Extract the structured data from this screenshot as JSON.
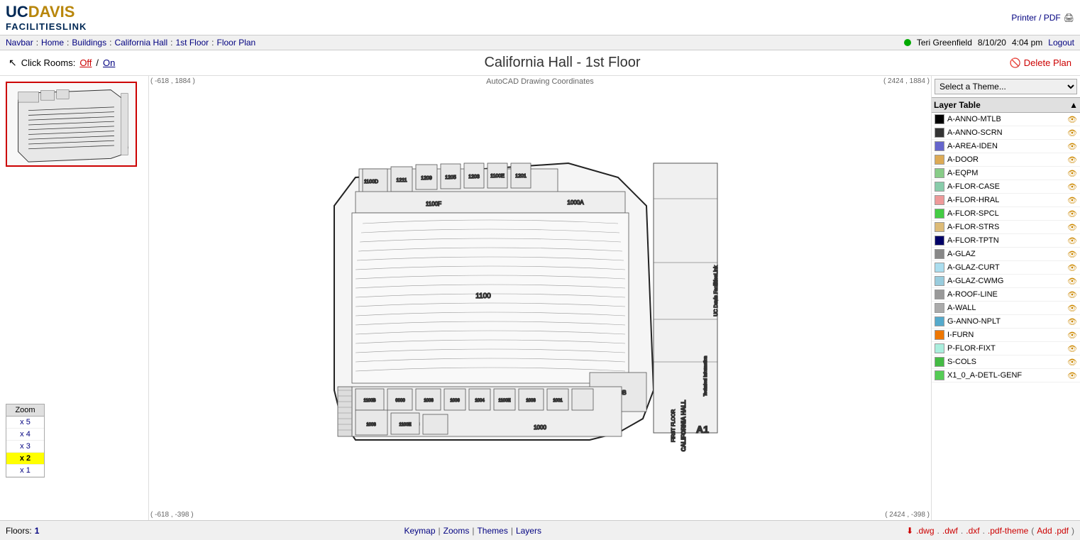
{
  "header": {
    "logo_uc": "UC",
    "logo_davis": "DAVIS",
    "logo_facilities": "FACILITIESLINK",
    "printer_pdf": "Printer / PDF"
  },
  "navbar": {
    "label": "Navbar",
    "items": [
      "Home",
      "Buildings",
      "California Hall",
      "1st Floor",
      "Floor Plan"
    ],
    "user": "Teri Greenfield",
    "date": "8/10/20",
    "time": "4:04 pm",
    "logout": "Logout"
  },
  "titlebar": {
    "click_rooms_label": "Click Rooms:",
    "click_rooms_off": "Off",
    "click_rooms_slash": "/",
    "click_rooms_on": "On",
    "title": "California Hall - 1st Floor",
    "delete_plan": "Delete Plan"
  },
  "map": {
    "coord_top_left": "( -618 , 1884 )",
    "coord_top_right": "( 2424 , 1884 )",
    "coord_bottom_left": "( -618 , -398 )",
    "coord_bottom_right": "( 2424 , -398 )",
    "autocad_label": "AutoCAD Drawing Coordinates"
  },
  "zoom": {
    "label": "Zoom",
    "levels": [
      "x 5",
      "x 4",
      "x 3",
      "x 2",
      "x 1"
    ],
    "active": "x 2"
  },
  "right_panel": {
    "theme_placeholder": "Select a Theme...",
    "layer_table_header": "Layer Table",
    "layers": [
      {
        "name": "A-ANNO-MTLB",
        "color": "#000000"
      },
      {
        "name": "A-ANNO-SCRN",
        "color": "#333333"
      },
      {
        "name": "A-AREA-IDEN",
        "color": "#6666cc"
      },
      {
        "name": "A-DOOR",
        "color": "#ddaa55"
      },
      {
        "name": "A-EQPM",
        "color": "#88cc88"
      },
      {
        "name": "A-FLOR-CASE",
        "color": "#88ccaa"
      },
      {
        "name": "A-FLOR-HRAL",
        "color": "#ee9999"
      },
      {
        "name": "A-FLOR-SPCL",
        "color": "#44cc44"
      },
      {
        "name": "A-FLOR-STRS",
        "color": "#ddbb77"
      },
      {
        "name": "A-FLOR-TPTN",
        "color": "#000066"
      },
      {
        "name": "A-GLAZ",
        "color": "#888888"
      },
      {
        "name": "A-GLAZ-CURT",
        "color": "#aaddee"
      },
      {
        "name": "A-GLAZ-CWMG",
        "color": "#99ccdd"
      },
      {
        "name": "A-ROOF-LINE",
        "color": "#999999"
      },
      {
        "name": "A-WALL",
        "color": "#aaaaaa"
      },
      {
        "name": "G-ANNO-NPLT",
        "color": "#55aacc"
      },
      {
        "name": "I-FURN",
        "color": "#ee7700"
      },
      {
        "name": "P-FLOR-FIXT",
        "color": "#aaeedd"
      },
      {
        "name": "S-COLS",
        "color": "#44bb44"
      },
      {
        "name": "X1_0_A-DETL-GENF",
        "color": "#55cc55"
      }
    ]
  },
  "bottom_bar": {
    "floors_label": "Floors:",
    "floors_value": "1",
    "keymap": "Keymap",
    "zooms": "Zooms",
    "themes": "Themes",
    "layers": "Layers",
    "downloads": [
      {
        "label": ".dwg",
        "url": "#"
      },
      {
        "label": ".dwf",
        "url": "#"
      },
      {
        "label": ".dxf",
        "url": "#"
      },
      {
        "label": ".pdf-theme",
        "url": "#"
      },
      {
        "label": "Add .pdf",
        "url": "#"
      }
    ]
  }
}
